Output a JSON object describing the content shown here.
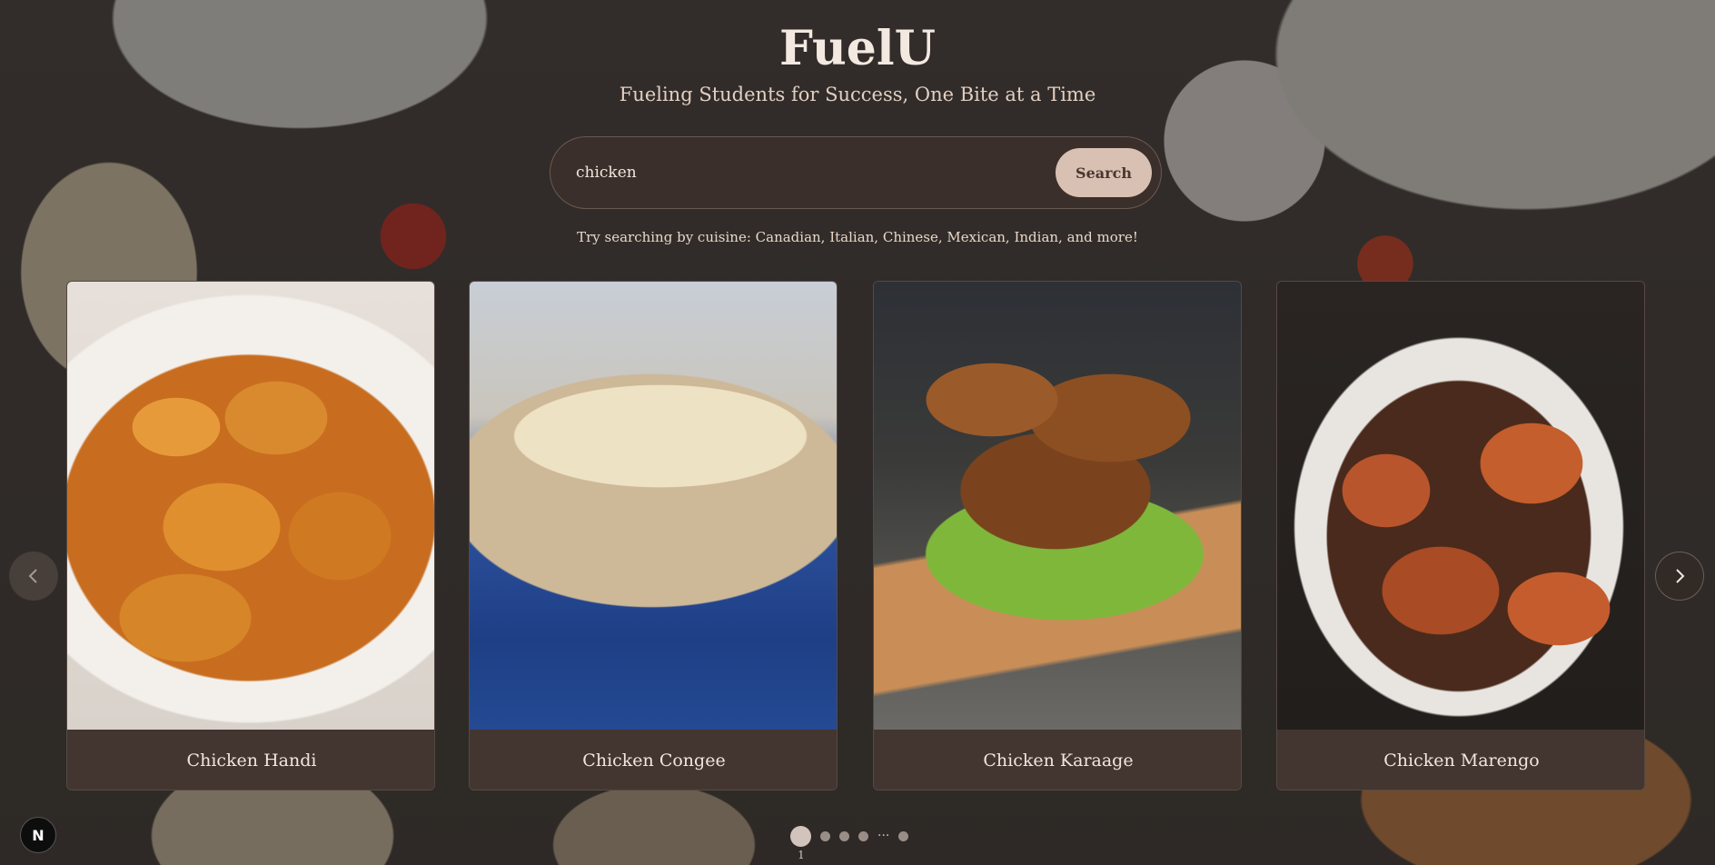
{
  "header": {
    "title": "FuelU",
    "subtitle": "Fueling Students for Success, One Bite at a Time"
  },
  "search": {
    "value": "chicken",
    "button_label": "Search"
  },
  "hint": "Try searching by cuisine: Canadian, Italian, Chinese, Mexican, Indian, and more!",
  "carousel": {
    "cards": [
      {
        "label": "Chicken Handi"
      },
      {
        "label": "Chicken Congee"
      },
      {
        "label": "Chicken Karaage"
      },
      {
        "label": "Chicken Marengo"
      }
    ],
    "pagination": {
      "current_page": "1",
      "ellipsis": "···"
    },
    "prev_icon": "chevron-left-icon",
    "next_icon": "chevron-right-icon"
  },
  "dev_badge": {
    "letter": "N"
  },
  "colors": {
    "background": "#3b3633",
    "card_label_bg": "#433530",
    "search_button": "#d8c0b3",
    "title": "#f3e9e1"
  }
}
